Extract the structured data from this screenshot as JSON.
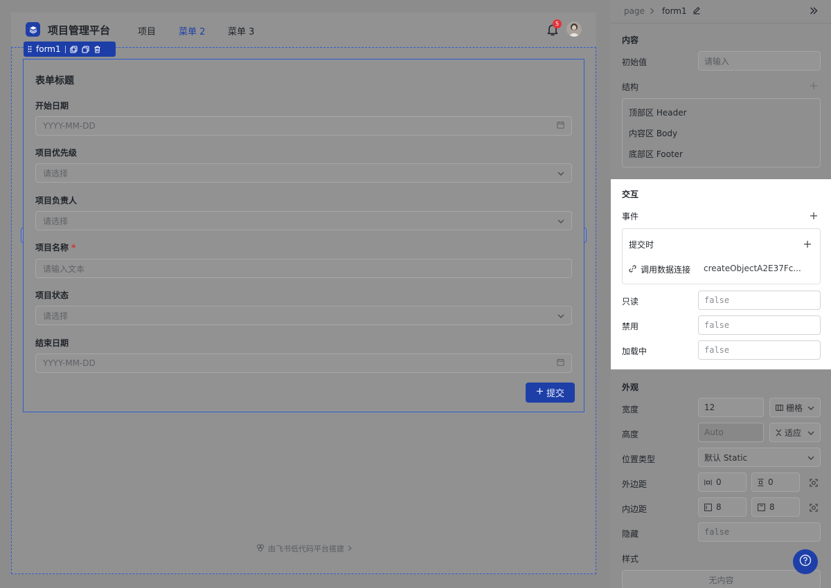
{
  "app": {
    "title": "项目管理平台",
    "nav": [
      "项目",
      "菜单 2",
      "菜单 3"
    ],
    "active_nav": "菜单 2",
    "notification_count": "5"
  },
  "selection": {
    "component_name": "form1"
  },
  "form": {
    "title": "表单标题",
    "fields": [
      {
        "label": "开始日期",
        "placeholder": "YYYY-MM-DD",
        "type": "date",
        "required": false
      },
      {
        "label": "项目优先级",
        "placeholder": "请选择",
        "type": "select",
        "required": false
      },
      {
        "label": "项目负责人",
        "placeholder": "请选择",
        "type": "select",
        "required": false
      },
      {
        "label": "项目名称",
        "placeholder": "请输入文本",
        "type": "text",
        "required": true
      },
      {
        "label": "项目状态",
        "placeholder": "请选择",
        "type": "select",
        "required": false
      },
      {
        "label": "结束日期",
        "placeholder": "YYYY-MM-DD",
        "type": "date",
        "required": false
      }
    ],
    "submit_label": "提交",
    "required_mark": "*"
  },
  "footer": {
    "credit": "由飞书低代码平台搭建"
  },
  "panel": {
    "breadcrumb": [
      "page",
      "form1"
    ],
    "content": {
      "section": "内容",
      "initial_value_label": "初始值",
      "initial_value_placeholder": "请输入",
      "structure_label": "结构",
      "structure_items": [
        "顶部区 Header",
        "内容区 Body",
        "底部区 Footer"
      ]
    },
    "interaction": {
      "section": "交互",
      "events_label": "事件",
      "event_name": "提交时",
      "action_label": "调用数据连接",
      "action_value": "createObjectA2E37Fc...",
      "readonly_label": "只读",
      "readonly_value": "false",
      "disabled_label": "禁用",
      "disabled_value": "false",
      "loading_label": "加载中",
      "loading_value": "false"
    },
    "appearance": {
      "section": "外观",
      "width_label": "宽度",
      "width_value": "12",
      "width_unit": "栅格",
      "height_label": "高度",
      "height_value": "Auto",
      "height_mode": "适应",
      "position_label": "位置类型",
      "position_value": "默认 Static",
      "margin_label": "外边距",
      "margin_h": "0",
      "margin_v": "0",
      "padding_label": "内边距",
      "padding_h": "8",
      "padding_v": "8",
      "hidden_label": "隐藏",
      "hidden_value": "false",
      "style_label": "样式",
      "style_value": "无内容"
    }
  },
  "colors": {
    "primary": "#1e3fa8",
    "selection": "#2f5bd1",
    "required": "#d3302f",
    "badge": "#e0363a"
  }
}
